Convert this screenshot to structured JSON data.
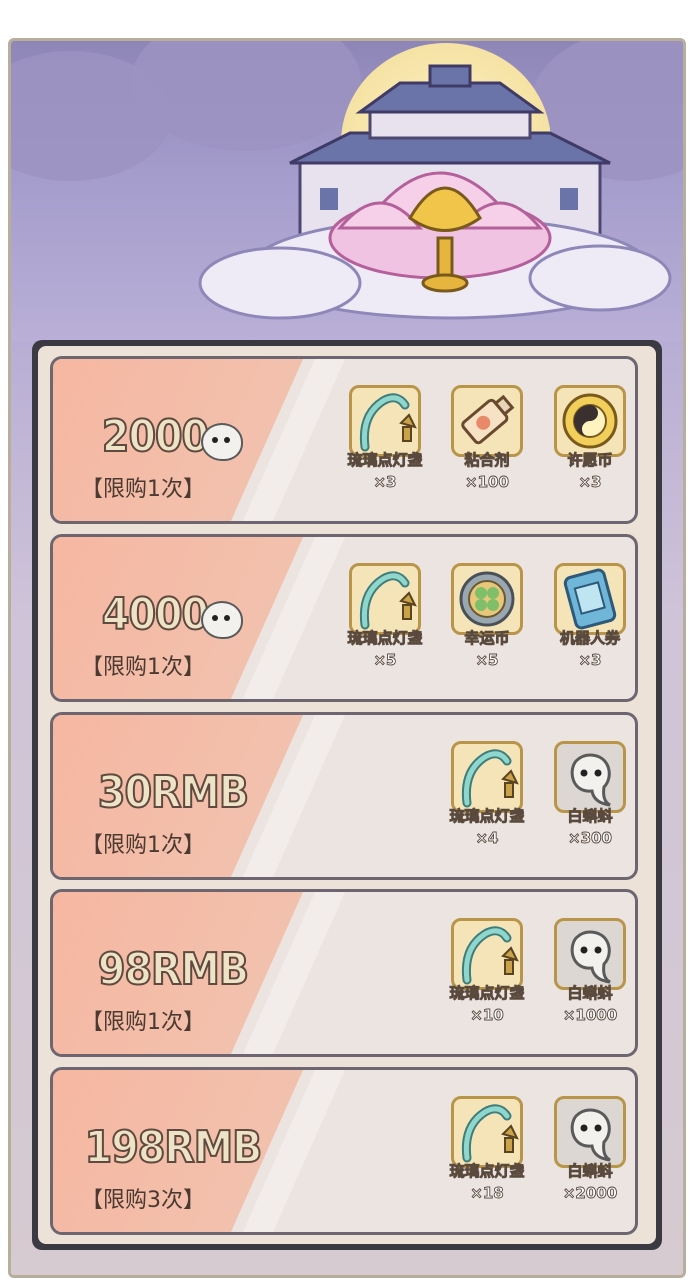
{
  "packs": [
    {
      "price": "2000",
      "limit": "【限购1次】",
      "items": [
        {
          "name": "琉璃点灯盏",
          "qty": "×3",
          "icon": "lamp-icon"
        },
        {
          "name": "粘合剂",
          "qty": "×100",
          "icon": "glue-tube-icon"
        },
        {
          "name": "许愿币",
          "qty": "×3",
          "icon": "wish-coin-icon"
        }
      ]
    },
    {
      "price": "4000",
      "limit": "【限购1次】",
      "items": [
        {
          "name": "琉璃点灯盏",
          "qty": "×5",
          "icon": "lamp-icon"
        },
        {
          "name": "幸运币",
          "qty": "×5",
          "icon": "lucky-coin-icon"
        },
        {
          "name": "机器人券",
          "qty": "×3",
          "icon": "robot-ticket-icon"
        }
      ]
    },
    {
      "price": "30RMB",
      "limit": "【限购1次】",
      "items": [
        {
          "name": "琉璃点灯盏",
          "qty": "×4",
          "icon": "lamp-icon"
        },
        {
          "name": "白蝌蚪",
          "qty": "×300",
          "icon": "tadpole-icon"
        }
      ]
    },
    {
      "price": "98RMB",
      "limit": "【限购1次】",
      "items": [
        {
          "name": "琉璃点灯盏",
          "qty": "×10",
          "icon": "lamp-icon"
        },
        {
          "name": "白蝌蚪",
          "qty": "×1000",
          "icon": "tadpole-icon"
        }
      ]
    },
    {
      "price": "198RMB",
      "limit": "【限购3次】",
      "items": [
        {
          "name": "琉璃点灯盏",
          "qty": "×18",
          "icon": "lamp-icon"
        },
        {
          "name": "白蝌蚪",
          "qty": "×2000",
          "icon": "tadpole-icon"
        }
      ]
    }
  ]
}
